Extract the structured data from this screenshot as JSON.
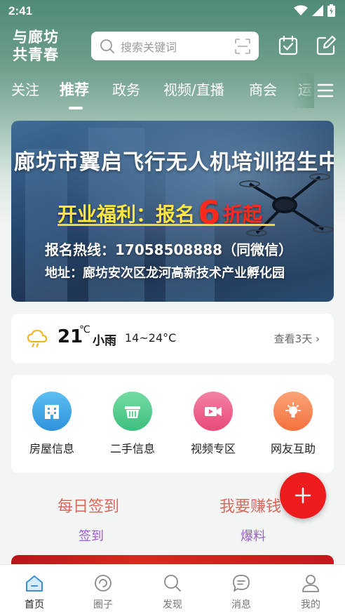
{
  "status_bar": {
    "time": "2:41"
  },
  "header": {
    "logo_line1": "与廊坊",
    "logo_line2": "共青春",
    "search_placeholder": "搜索关键词"
  },
  "channels": {
    "tabs": [
      "关注",
      "推荐",
      "政务",
      "视频/直播",
      "商会",
      "运"
    ],
    "active": "推荐"
  },
  "banner": {
    "title": "廊坊市翼启飞行无人机培训招生中",
    "promo_text": "开业福利：报名",
    "promo_number": "6",
    "promo_tail": "折起",
    "hotline": "报名热线：17058508888（同微信）",
    "address": "地址：廊坊安次区龙河高新技术产业孵化园"
  },
  "weather": {
    "temperature": "21",
    "unit": "℃",
    "condition": "小雨",
    "range": "14~24°C",
    "forecast_link": "查看3天"
  },
  "services": [
    {
      "label": "房屋信息",
      "icon": "building-icon",
      "color": "#3fa6e8"
    },
    {
      "label": "二手信息",
      "icon": "basket-icon",
      "color": "#4fcf8e"
    },
    {
      "label": "视频专区",
      "icon": "video-camera-icon",
      "color": "#ef5d8a"
    },
    {
      "label": "网友互助",
      "icon": "lightbulb-icon",
      "color": "#f7874f"
    }
  ],
  "actions": {
    "left_title": "每日签到",
    "left_sub": "签到",
    "right_title": "我要赚钱",
    "right_sub": "爆料"
  },
  "bottom_nav": {
    "items": [
      "首页",
      "圈子",
      "发现",
      "消息",
      "我的"
    ],
    "active": "首页"
  },
  "colors": {
    "accent_red": "#ee1d1d",
    "nav_active": "#3a8fd6",
    "action_title": "#d86a5c",
    "action_sub": "#9a5fc9"
  }
}
